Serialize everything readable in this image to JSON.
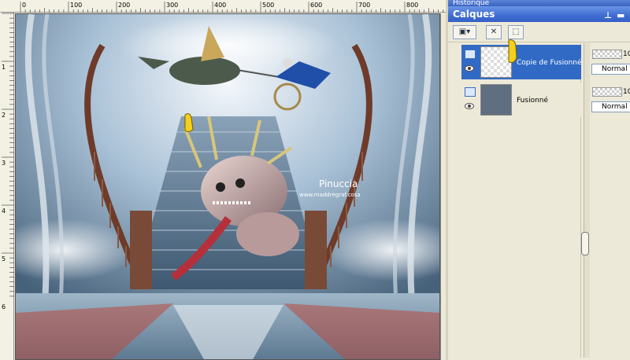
{
  "rulers": {
    "horizontal_labels": [
      "0",
      "100",
      "200",
      "300",
      "400",
      "500",
      "600",
      "700",
      "800"
    ],
    "vertical_labels": [
      "1",
      "2",
      "3",
      "4",
      "5",
      "6"
    ]
  },
  "canvas": {
    "watermark_title": "Pinuccia",
    "watermark_url": "www.maddregraf.cosa"
  },
  "panel": {
    "history_tab": "Historique",
    "title": "Calques",
    "pin_icon": "pin-icon",
    "minimize_icon": "minimize-icon"
  },
  "toolbar": {
    "new_layer_icon": "new-layer-icon",
    "delete_layer_icon": "delete-layer-icon",
    "mask_icon": "mask-icon"
  },
  "layers": [
    {
      "name": "Copie de Fusionné",
      "selected": true,
      "opacity": "10",
      "blend": "Normal"
    },
    {
      "name": "Fusionné",
      "selected": false,
      "opacity": "10",
      "blend": "Normal"
    }
  ],
  "colors": {
    "selection": "#316ac5",
    "panel_bg": "#ece9d8",
    "title_bar": "#3f6cd0"
  }
}
